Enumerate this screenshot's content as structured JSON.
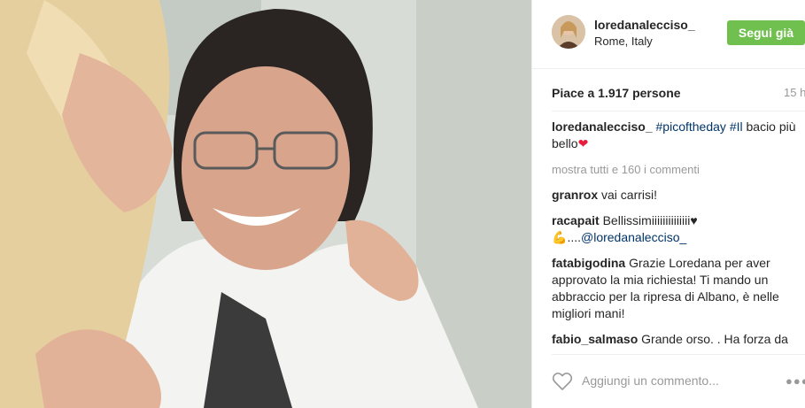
{
  "header": {
    "username": "loredanalecciso_",
    "location": "Rome, Italy",
    "follow_label": "Segui già"
  },
  "meta": {
    "likes": "Piace a 1.917 persone",
    "timestamp": "15 h"
  },
  "caption": {
    "user": "loredanalecciso_",
    "hashtag1": "#picoftheday",
    "hashtag2": "#Il",
    "text": "bacio più bello",
    "emoji": "heart"
  },
  "view_all": "mostra tutti e 160 i commenti",
  "comments": [
    {
      "user": "granrox",
      "text": "vai carrisi!"
    },
    {
      "user": "racapait",
      "text": "Bellissimiiiiiiiiiiiiii",
      "mention_prefix": "....",
      "mention": "@loredanalecciso_"
    },
    {
      "user": "fatabigodina",
      "text": "Grazie Loredana per aver approvato la mia richiesta! Ti mando un abbraccio per la ripresa di Albano, è nelle migliori mani!"
    },
    {
      "user": "fabio_salmaso",
      "text": "Grande orso. . Ha forza da vendere ti aspettiamo a San Remo"
    }
  ],
  "comment_box": {
    "placeholder": "Aggiungi un commento..."
  },
  "icons": {
    "like": "heart-outline-icon",
    "more": "more-options-icon"
  },
  "colors": {
    "follow_button": "#70c050",
    "link": "#003569",
    "muted": "#999999",
    "heart": "#e81c3c"
  }
}
